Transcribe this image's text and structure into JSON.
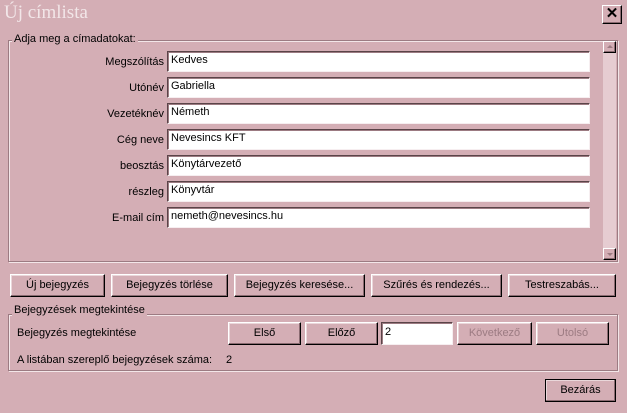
{
  "window": {
    "title": "Új címlista",
    "close_glyph": "✕"
  },
  "entry_group": {
    "legend": "Adja meg a címadatokat:",
    "fields": [
      {
        "label": "Megszólítás",
        "value": "Kedves"
      },
      {
        "label": "Utónév",
        "value": "Gabriella"
      },
      {
        "label": "Vezetéknév",
        "value": "Németh"
      },
      {
        "label": "Cég neve",
        "value": "Nevesincs KFT"
      },
      {
        "label": "beosztás",
        "value": "Könytárvezető"
      },
      {
        "label": "részleg",
        "value": "Könyvtár"
      },
      {
        "label": "E-mail cím",
        "value": "nemeth@nevesincs.hu"
      }
    ]
  },
  "actions": {
    "new_entry": "Új bejegyzés",
    "delete_entry": "Bejegyzés törlése",
    "find_entry": "Bejegyzés keresése...",
    "filter_sort": "Szűrés és rendezés...",
    "customize": "Testreszabás..."
  },
  "view_group": {
    "legend": "Bejegyzések megtekintése",
    "view_label": "Bejegyzés megtekintése",
    "first": "Első",
    "previous": "Előző",
    "current_entry": "2",
    "next": "Következő",
    "last": "Utolsó",
    "count_label": "A listában szereplő bejegyzések száma:",
    "count_value": "2"
  },
  "footer": {
    "close": "Bezárás"
  },
  "colors": {
    "background": "#d4aeb5",
    "field": "#ffffff",
    "shadow": "#9c7b82"
  }
}
